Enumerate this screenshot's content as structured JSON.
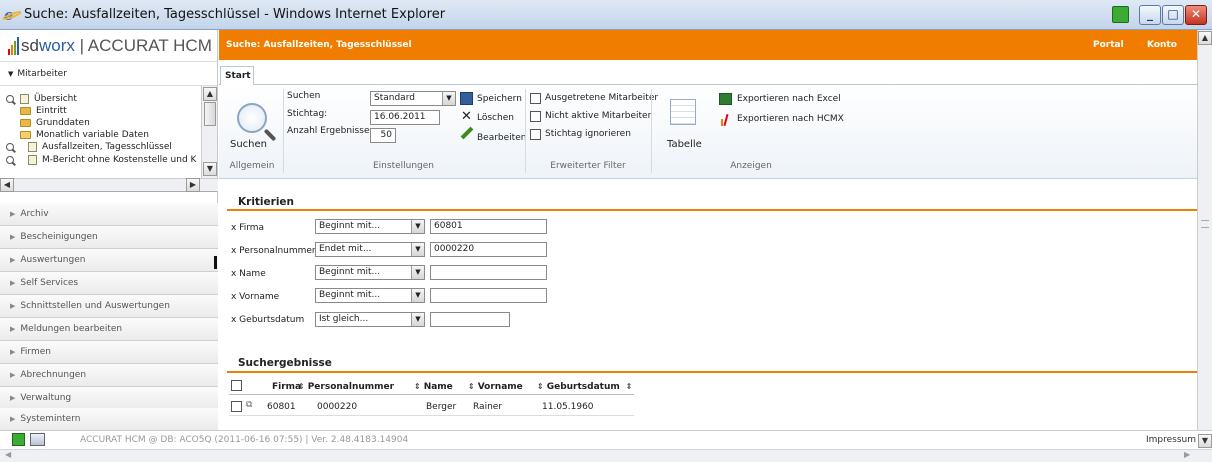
{
  "window": {
    "title": "Suche: Ausfallzeiten, Tagesschlüssel - Windows Internet Explorer"
  },
  "brand": {
    "sd": "sd",
    "worx": "worx",
    "product": "| ACCURAT HCM"
  },
  "sidebar": {
    "section": "Mitarbeiter",
    "tree": [
      "Übersicht",
      "Eintritt",
      "Grunddaten",
      "Monatlich variable Daten",
      "Ausfallzeiten, Tagesschlüssel",
      "M-Bericht ohne Kostenstelle und K"
    ],
    "accordion": [
      "Archiv",
      "Bescheinigungen",
      "Auswertungen",
      "Self Services",
      "Schnittstellen und Auswertungen",
      "Meldungen bearbeiten",
      "Firmen",
      "Abrechnungen",
      "Verwaltung",
      "Systemintern"
    ]
  },
  "header": {
    "page_title": "Suche: Ausfallzeiten, Tagesschlüssel",
    "portal": "Portal",
    "konto": "Konto"
  },
  "ribbon": {
    "tab": "Start",
    "search_label": "Suchen",
    "groups": {
      "allgemein": "Allgemein",
      "einstellungen": "Einstellungen",
      "filter": "Erweiterter Filter",
      "anzeigen": "Anzeigen"
    },
    "suchen_label": "Suchen",
    "suchen_value": "Standard",
    "stichtag_label": "Stichtag:",
    "stichtag_value": "16.06.2011",
    "anzahl_label": "Anzahl Ergebnisse:",
    "anzahl_value": "50",
    "speichern": "Speichern",
    "loeschen": "Löschen",
    "bearbeiten": "Bearbeiten",
    "filter_items": [
      "Ausgetretene Mitarbeiter",
      "Nicht aktive Mitarbeiter",
      "Stichtag ignorieren"
    ],
    "tabelle": "Tabelle",
    "export_excel": "Exportieren nach Excel",
    "export_hcmx": "Exportieren nach HCMX"
  },
  "criteria": {
    "title": "Kritierien",
    "rows": [
      {
        "label": "x Firma",
        "op": "Beginnt mit...",
        "value": "60801"
      },
      {
        "label": "x Personalnummer",
        "op": "Endet mit...",
        "value": "0000220"
      },
      {
        "label": "x Name",
        "op": "Beginnt mit...",
        "value": ""
      },
      {
        "label": "x Vorname",
        "op": "Beginnt mit...",
        "value": ""
      },
      {
        "label": "x Geburtsdatum",
        "op": "Ist gleich...",
        "value": ""
      }
    ]
  },
  "results": {
    "title": "Suchergebnisse",
    "columns": [
      "Firma",
      "Personalnummer",
      "Name",
      "Vorname",
      "Geburtsdatum"
    ],
    "rows": [
      [
        "60801",
        "0000220",
        "Berger",
        "Rainer",
        "11.05.1960"
      ]
    ]
  },
  "status": {
    "text": "ACCURAT HCM @ DB: ACO5Q (2011-06-16 07:55) | Ver. 2.48.4183.14904",
    "impressum": "Impressum"
  }
}
